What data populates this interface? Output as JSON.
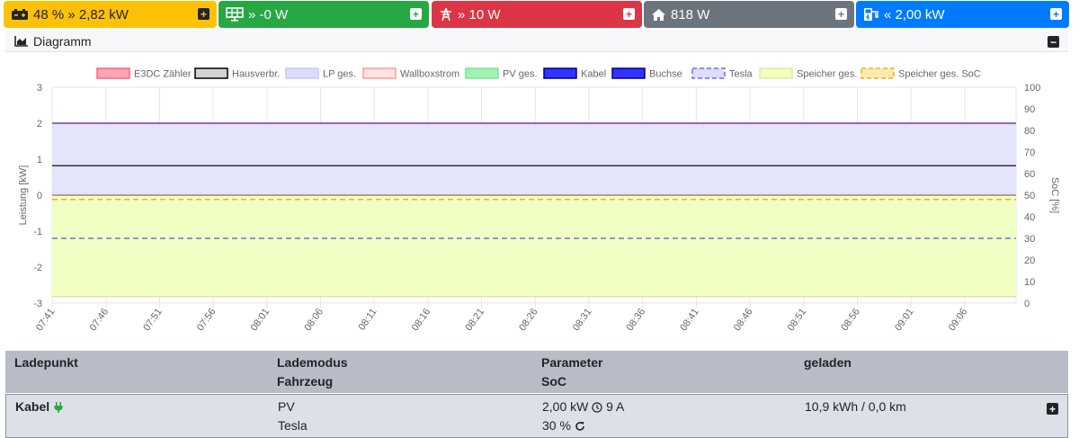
{
  "tiles": {
    "battery": {
      "text": "48 % » 2,82 kW",
      "icon": "battery-car-icon"
    },
    "pv": {
      "text": "» -0 W",
      "icon": "solar-panel-icon"
    },
    "grid": {
      "text": "» 10 W",
      "icon": "power-pylon-icon"
    },
    "house": {
      "text": "818 W",
      "icon": "house-icon"
    },
    "chargepoint": {
      "text": "« 2,00 kW",
      "icon": "charging-station-icon"
    }
  },
  "diagram": {
    "title": "Diagramm"
  },
  "chart_data": {
    "type": "area",
    "legend": [
      {
        "label": "E3DC Zähler",
        "fill": "#ffa5b4",
        "stroke": "#ff6384",
        "dashed": false
      },
      {
        "label": "Hausverbr.",
        "fill": "#d3d3d3",
        "stroke": "#000000",
        "dashed": false
      },
      {
        "label": "LP ges.",
        "fill": "#dcdcff",
        "stroke": "#c8c8f0",
        "dashed": false
      },
      {
        "label": "Wallboxstrom",
        "fill": "#ffe4e4",
        "stroke": "#ff9999",
        "dashed": false
      },
      {
        "label": "PV ges.",
        "fill": "#a0f0b4",
        "stroke": "#7ce49a",
        "dashed": false
      },
      {
        "label": "Kabel",
        "fill": "#3333ff",
        "stroke": "#000080",
        "dashed": false
      },
      {
        "label": "Buchse",
        "fill": "#3333ff",
        "stroke": "#000080",
        "dashed": false
      },
      {
        "label": "Tesla",
        "fill": "#dcdcff",
        "stroke": "#6e6ee6",
        "dashed": true
      },
      {
        "label": "Speicher ges.",
        "fill": "#f2ffbd",
        "stroke": "#e6e6a0",
        "dashed": false
      },
      {
        "label": "Speicher ges. SoC",
        "fill": "#ffe9b0",
        "stroke": "#e6b41e",
        "dashed": true
      }
    ],
    "x_ticks": [
      "07:41",
      "07:46",
      "07:51",
      "07:56",
      "08:01",
      "08:06",
      "08:11",
      "08:16",
      "08:21",
      "08:26",
      "08:31",
      "08:36",
      "08:41",
      "08:46",
      "08:51",
      "08:56",
      "09:01",
      "09:06"
    ],
    "y_left": {
      "label": "Leistung [kW]",
      "min": -3,
      "max": 3,
      "ticks": [
        "3",
        "2",
        "1",
        "0",
        "-1",
        "-2",
        "-3"
      ]
    },
    "y_right": {
      "label": "SoC [%]",
      "min": 0,
      "max": 100,
      "ticks": [
        "100",
        "90",
        "80",
        "70",
        "60",
        "50",
        "40",
        "30",
        "20",
        "10",
        "0"
      ]
    },
    "series": [
      {
        "name": "LP ges.",
        "axis": "left",
        "value": 2.0
      },
      {
        "name": "Hausverbr.",
        "axis": "left",
        "value": 0.818
      },
      {
        "name": "Speicher ges.",
        "axis": "left",
        "value": -2.82
      },
      {
        "name": "Speicher ges. SoC",
        "axis": "right",
        "value": 48
      },
      {
        "name": "Tesla",
        "axis": "right",
        "value": 30
      }
    ],
    "grid": true
  },
  "table": {
    "headers": {
      "ladepunkt": "Ladepunkt",
      "lademodus": "Lademodus",
      "fahrzeug": "Fahrzeug",
      "parameter": "Parameter",
      "soc": "SoC",
      "geladen": "geladen"
    },
    "row": {
      "name": "Kabel",
      "mode": "PV",
      "vehicle": "Tesla",
      "power": "2,00 kW",
      "current": "9 A",
      "soc": "30 %",
      "charged": "10,9 kWh / 0,0 km"
    }
  }
}
